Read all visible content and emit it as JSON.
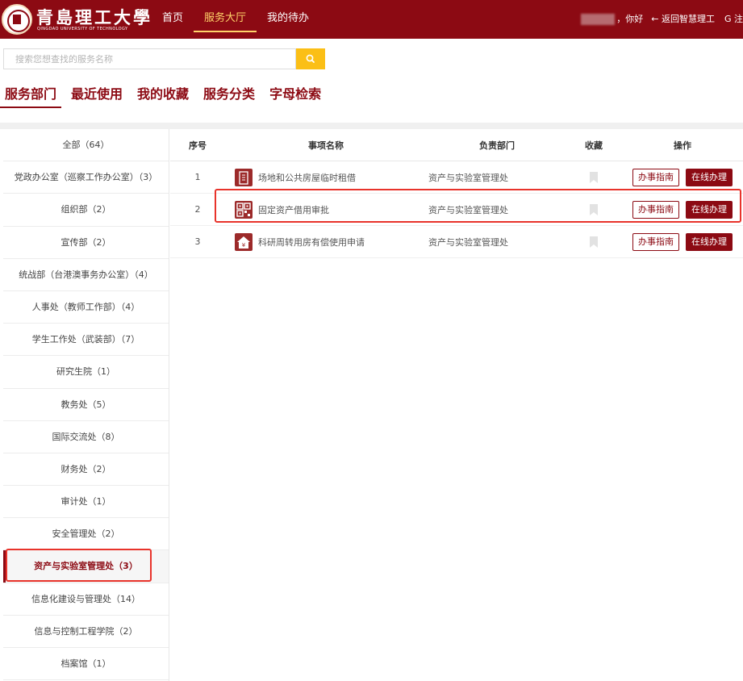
{
  "header": {
    "logo_cn": "青島理工大學",
    "logo_en": "QINGDAO UNIVERSITY OF TECHNOLOGY",
    "nav": [
      "首页",
      "服务大厅",
      "我的待办"
    ],
    "active_nav": "服务大厅",
    "greeting": "，你好",
    "back_label": "← 返回智慧理工",
    "logout_label": "G 注"
  },
  "search": {
    "placeholder": "搜索您想查找的服务名称",
    "icon": "search-icon"
  },
  "tabs": [
    "服务部门",
    "最近使用",
    "我的收藏",
    "服务分类",
    "字母检索"
  ],
  "active_tab": "服务部门",
  "departments": [
    "全部（64）",
    "党政办公室（巡察工作办公室）（3）",
    "组织部（2）",
    "宣传部（2）",
    "统战部（台港澳事务办公室）（4）",
    "人事处（教师工作部）（4）",
    "学生工作处（武装部）（7）",
    "研究生院（1）",
    "教务处（5）",
    "国际交流处（8）",
    "财务处（2）",
    "审计处（1）",
    "安全管理处（2）",
    "资产与实验室管理处（3）",
    "信息化建设与管理处（14）",
    "信息与控制工程学院（2）",
    "档案馆（1）"
  ],
  "active_department": "资产与实验室管理处（3）",
  "table": {
    "headers": [
      "序号",
      "事项名称",
      "负责部门",
      "收藏",
      "操作"
    ],
    "rows": [
      {
        "no": "1",
        "name": "场地和公共房屋临时租借",
        "dept": "资产与实验室管理处",
        "icon": "building-icon"
      },
      {
        "no": "2",
        "name": "固定资产借用审批",
        "dept": "资产与实验室管理处",
        "icon": "qr-code-icon"
      },
      {
        "no": "3",
        "name": "科研周转用房有偿使用申请",
        "dept": "资产与实验室管理处",
        "icon": "house-yen-icon"
      }
    ],
    "guide_label": "办事指南",
    "online_label": "在线办理"
  },
  "colors": {
    "brand": "#8c0a13",
    "accent": "#ffd36a",
    "search_button": "#fbbf16",
    "highlight": "#e8332b"
  }
}
